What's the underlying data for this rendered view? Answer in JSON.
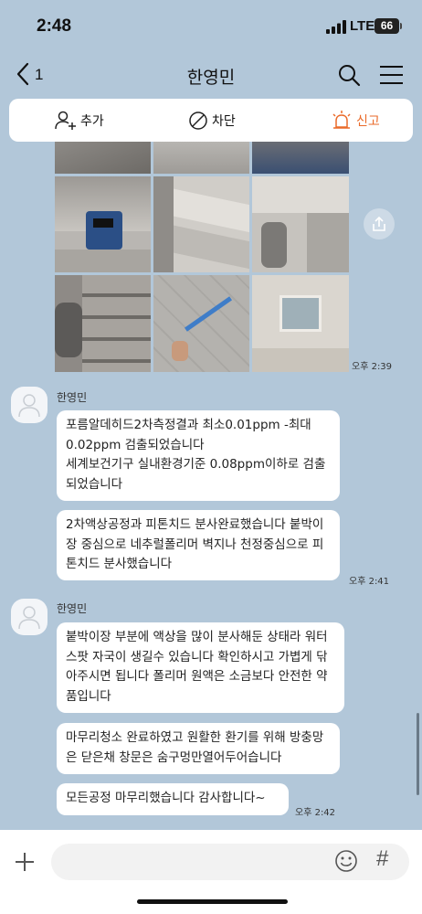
{
  "status": {
    "time": "2:48",
    "network": "LTE",
    "battery": "66"
  },
  "header": {
    "back_count": "1",
    "title": "한영민"
  },
  "actions": {
    "add": "추가",
    "block": "차단",
    "report": "신고"
  },
  "messages": {
    "photos_time": "오후 2:39",
    "sender_1": "한영민",
    "bubble_1": "포름알데히드2차측정결과 최소0.01ppm -최대0.02ppm 검출되었습니다\n세계보건기구 실내환경기준 0.08ppm이하로 검출되었습니다",
    "bubble_2": "2차액상공정과 피톤치드 분사완료했습니다 붙박이장 중심으로 네추럴폴리머 벽지나 천정중심으로 피톤치드 분사했습니다",
    "time_1": "오후 2:41",
    "sender_2": "한영민",
    "bubble_3": "붙박이장 부분에 액상을 많이 분사해둔 상태라 워터스팟 자국이 생길수 있습니다 확인하시고 가볍게 닦아주시면 됩니다 폴리머 원액은 소금보다 안전한 약품입니다",
    "bubble_4": "마무리청소 완료하였고 원활한 환기를 위해 방충망은 닫은채 창문은 숨구멍만열어두어습니다",
    "bubble_5": "모든공정 마무리했습니다 감사합니다~",
    "time_2": "오후 2:42"
  },
  "icons": [
    "add-friend-icon",
    "block-icon",
    "report-bell-icon",
    "search-icon",
    "menu-icon",
    "back-icon",
    "share-icon",
    "plus-icon",
    "emoji-icon",
    "hash-icon"
  ],
  "colors": {
    "background": "#b2c7d9",
    "report": "#ea6a29",
    "bubble": "#ffffff"
  }
}
